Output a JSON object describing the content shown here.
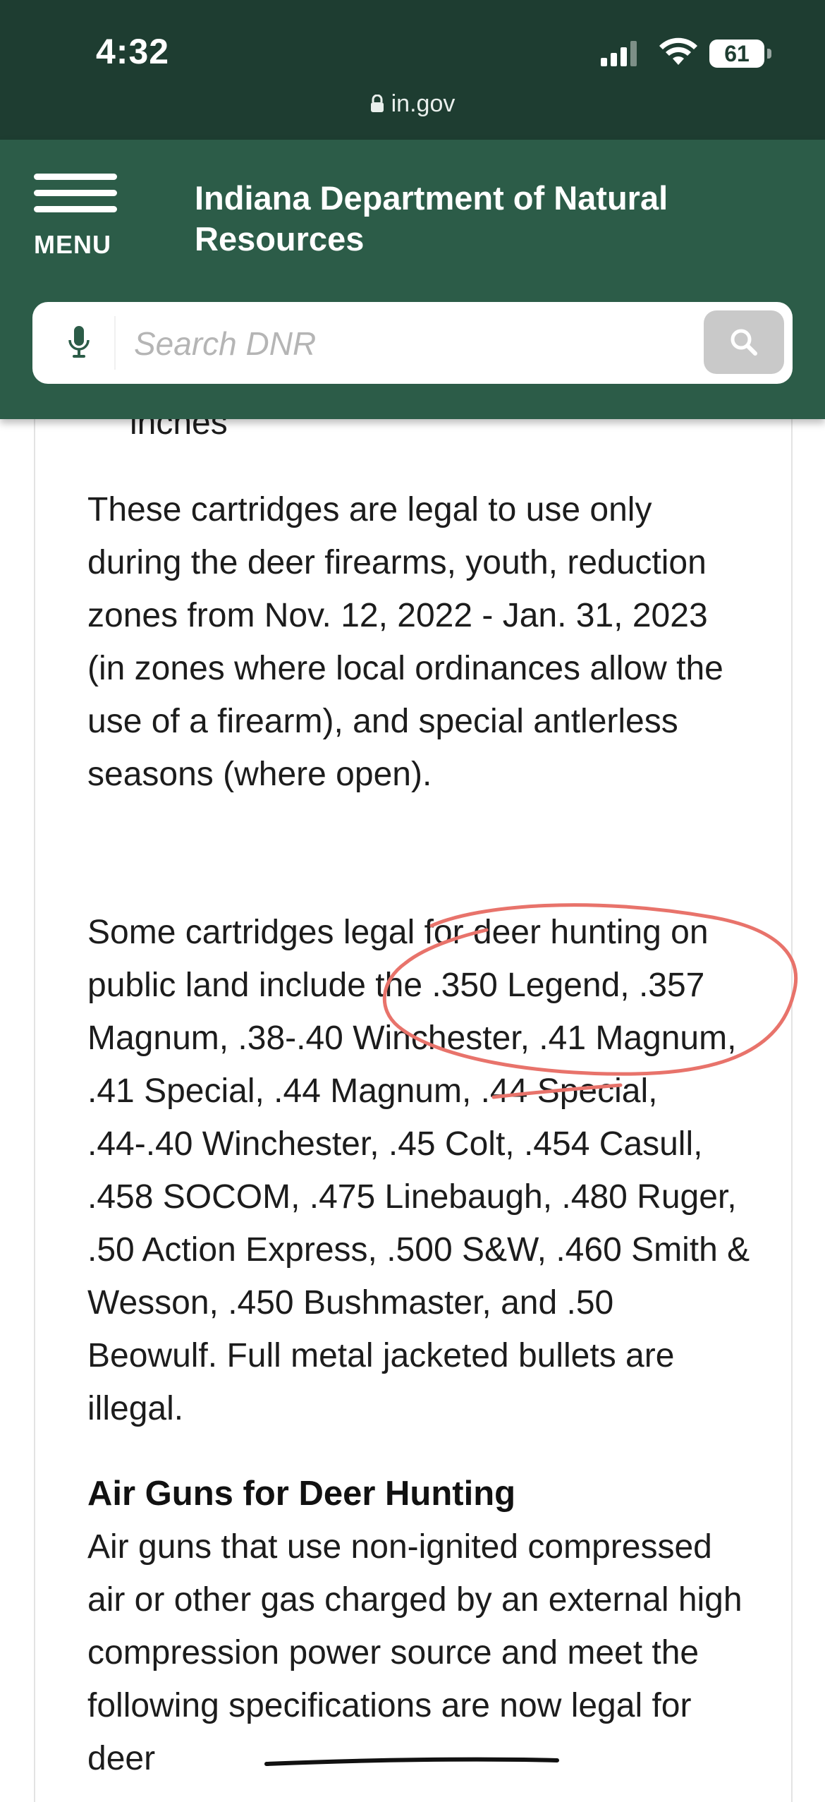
{
  "status_bar": {
    "time": "4:32",
    "battery": "61",
    "url": "in.gov"
  },
  "header": {
    "menu_label": "MENU",
    "site_title": "Indiana Department of Natural Resources",
    "search_placeholder": "Search DNR",
    "background_color": "#2c5c48",
    "status_color": "#1e3d31"
  },
  "content": {
    "cut_text": "inches",
    "paragraph_1": "These cartridges are legal to use only during the deer firearms, youth, reduction zones from Nov. 12, 2022 - Jan. 31, 2023 (in zones where local ordinances allow the use of a firearm), and special antlerless seasons (where open).",
    "paragraph_2": "Some cartridges legal for deer hunting on public land include the .350 Legend, .357 Magnum, .38-.40 Winchester, .41 Magnum, .41 Special, .44 Magnum, .44 Special, .44-.40 Winchester, .45 Colt, .454 Casull, .458 SOCOM, .475 Linebaugh, .480 Ruger, .50 Action Express, .500 S&W, .460 Smith & Wesson, .450 Bushmaster, and .50 Beowulf. Full metal jacketed bullets are illegal.",
    "heading_air_guns": "Air Guns for Deer Hunting",
    "paragraph_3": "Air guns that use non-ignited compressed air or other gas charged by an external high compression power source and meet the following specifications are now legal for deer"
  },
  "annotations": {
    "circle_color": "#e8736b",
    "strike_color": "#111111"
  }
}
